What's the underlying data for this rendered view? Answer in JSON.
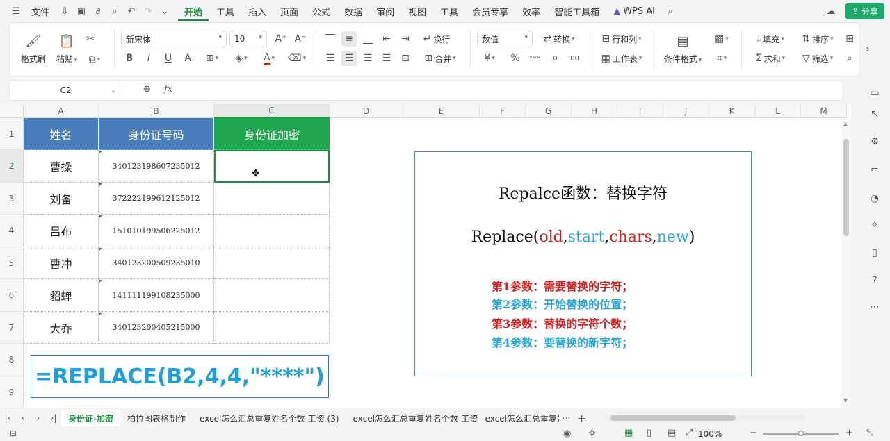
{
  "menubar": {
    "file": "文件",
    "tabs": [
      "开始",
      "工具",
      "插入",
      "页面",
      "公式",
      "数据",
      "审阅",
      "视图",
      "工具",
      "会员专享",
      "效率",
      "智能工具箱"
    ],
    "wps_ai": "WPS AI",
    "share": "分享"
  },
  "ribbon": {
    "format_painter": "格式刷",
    "paste": "粘贴",
    "font_name": "新宋体",
    "font_size": "10",
    "wrap": "换行",
    "merge": "合并",
    "number_format": "数值",
    "convert": "转换",
    "row_col": "行和列",
    "worksheet": "工作表",
    "cond_format": "条件格式",
    "fill": "填充",
    "sort": "排序",
    "sum": "求和",
    "filter": "筛选"
  },
  "formula_bar": {
    "cell_ref": "C2",
    "fx": "fx"
  },
  "sheet": {
    "columns": [
      "A",
      "B",
      "C",
      "D",
      "E",
      "F",
      "G",
      "H",
      "I",
      "J",
      "K",
      "L",
      "M"
    ],
    "rows": [
      "1",
      "2",
      "3",
      "4",
      "5",
      "6",
      "7",
      "8",
      "9"
    ],
    "headers": [
      "姓名",
      "身份证号码",
      "身份证加密"
    ],
    "data": [
      {
        "name": "曹操",
        "id": "340123198607235012"
      },
      {
        "name": "刘备",
        "id": "372222199612125012"
      },
      {
        "name": "吕布",
        "id": "151010199506225012"
      },
      {
        "name": "曹冲",
        "id": "340123200509235010"
      },
      {
        "name": "貂蝉",
        "id": "141111199108235000"
      },
      {
        "name": "大乔",
        "id": "340123200405215000"
      }
    ],
    "formula_display": "=REPLACE(B2,4,4,\"****\")"
  },
  "info": {
    "title": "Repalce函数：替换字符",
    "syntax_prefix": "Replace(",
    "arg_old": "old",
    "arg_start": "start",
    "arg_chars": "chars",
    "arg_new": "new",
    "comma": ",",
    "syntax_suffix": ")",
    "params": [
      {
        "text": "第1参数：需要替换的字符；",
        "color": "#d42020"
      },
      {
        "text": "第2参数：开始替换的位置；",
        "color": "#28a6d6"
      },
      {
        "text": "第3参数：替换的字符个数；",
        "color": "#d42020"
      },
      {
        "text": "第4参数：要替换的新字符；",
        "color": "#28a6d6"
      }
    ]
  },
  "sheet_tabs": [
    "身份证-加密",
    "柏拉图表格制作",
    "excel怎么汇总重复姓名个数-工资 (3)",
    "excel怎么汇总重复姓名个数-工资",
    "excel怎么汇总重复姓"
  ],
  "status": {
    "zoom": "100%"
  },
  "colors": {
    "header_blue": "#4a7ebb",
    "header_green": "#1fa84f",
    "accent": "#1e8e3e",
    "formula_text": "#1ea0d6"
  }
}
